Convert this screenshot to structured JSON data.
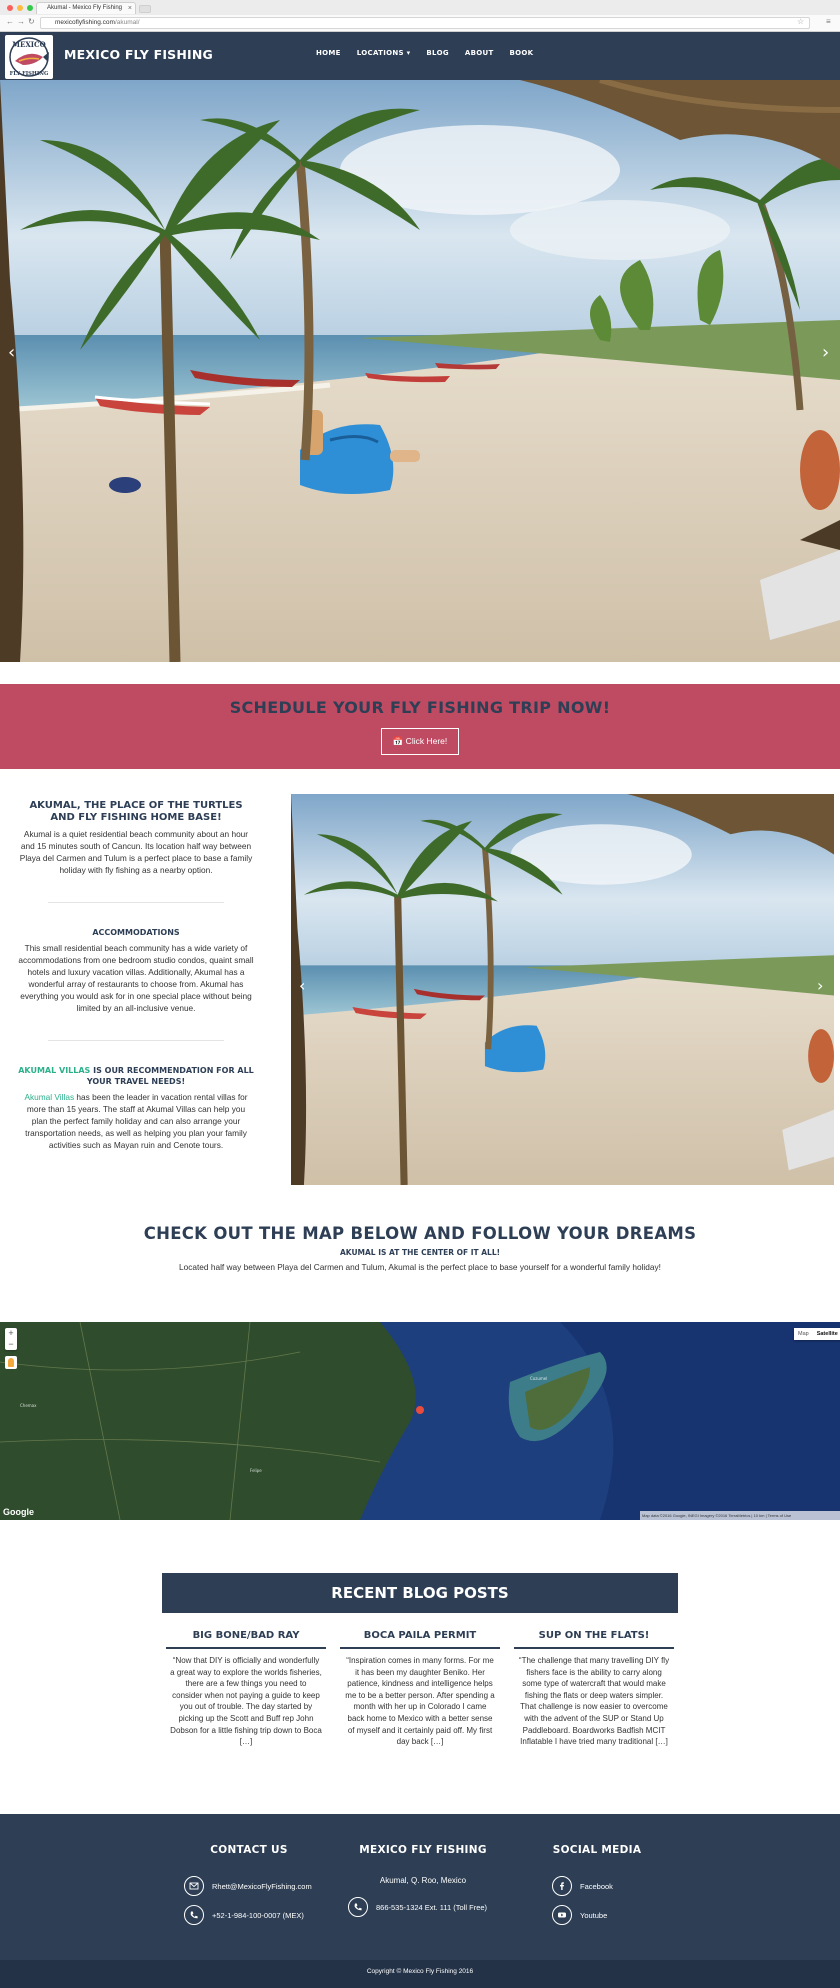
{
  "browser": {
    "tab_title": "Akumal - Mexico Fly Fishing",
    "tab_close": "×",
    "url_domain": "mexicoflyfishing.com",
    "url_path": "/akumal/"
  },
  "header": {
    "logo_text_top": "MEXICO",
    "logo_text_bottom": "FLY FISHING",
    "site_title": "MEXICO FLY FISHING",
    "nav": [
      "HOME",
      "LOCATIONS ▾",
      "BLOG",
      "ABOUT",
      "BOOK"
    ]
  },
  "hero": {
    "prev_arrow": "‹",
    "next_arrow": "›"
  },
  "cta": {
    "heading": "SCHEDULE YOUR FLY FISHING TRIP NOW!",
    "button_label": "📅 Click Here!"
  },
  "akumal": {
    "heading": "AKUMAL, THE PLACE OF THE TURTLES AND FLY FISHING HOME BASE!",
    "intro": "Akumal is a quiet residential beach community about an hour and 15 minutes south of Cancun. Its location half way between Playa del Carmen and Tulum is a perfect place to base a family holiday with fly fishing as a nearby option.",
    "accommodations_heading": "ACCOMMODATIONS",
    "accommodations_text": "This small residential beach community has a wide variety of accommodations from one bedroom studio condos, quaint small hotels and luxury vacation villas. Additionally, Akumal has a wonderful array of restaurants to choose from. Akumal has everything you would ask for in one special place without being limited by an all-inclusive venue.",
    "villas_link": "AKUMAL VILLAS",
    "villas_heading_rest": " IS OUR RECOMMENDATION FOR ALL YOUR TRAVEL NEEDS!",
    "villas_text_link": "Akumal Villas",
    "villas_text": " has been the leader in vacation rental villas for more than 15 years. The staff at Akumal Villas can help you plan the perfect family holiday and can also arrange your transportation needs, as well as helping you plan your family activities such as Mayan ruin and Cenote tours."
  },
  "map_section": {
    "heading": "CHECK OUT THE MAP BELOW AND FOLLOW YOUR DREAMS",
    "subheading": "AKUMAL IS AT THE CENTER OF IT ALL!",
    "text": "Located half way between Playa del Carmen and Tulum, Akumal is the perfect place to base yourself for a wonderful family holiday!",
    "zoom_in": "+",
    "zoom_out": "−",
    "map_type_map": "Map",
    "map_type_satellite": "Satellite",
    "google": "Google",
    "attribution": "Map data ©2016 Google, INEGI Imagery ©2016 TerraMetrics | 10 km | Terms of Use"
  },
  "blog": {
    "heading": "RECENT BLOG POSTS",
    "posts": [
      {
        "title": "BIG BONE/BAD RAY",
        "excerpt": "“Now that DIY is officially and wonderfully a great way to explore the worlds fisheries, there are a few things you need to consider when not paying a guide to keep you out of trouble. The day started by picking up the Scott and Buff rep John Dobson for a little fishing trip down to Boca […]"
      },
      {
        "title": "BOCA PAILA PERMIT",
        "excerpt": "“Inspiration comes in many forms. For me it has been my daughter Beniko. Her patience, kindness and intelligence helps me to be a better person. After spending a month with her up in Colorado I came back home to Mexico with a better sense of myself and it certainly paid off.  My first day back […]"
      },
      {
        "title": "SUP ON THE FLATS!",
        "excerpt": "“The challenge that many travelling DIY fly fishers face is the ability to carry along some type of watercraft that would make fishing the flats or deep waters simpler. That challenge is now easier to overcome with the advent of the SUP or Stand Up Paddleboard. Boardworks Badfish MCIT Inflatable I have tried many traditional […]"
      }
    ]
  },
  "footer": {
    "contact_heading": "CONTACT US",
    "email": "Rhett@MexicoFlyFishing.com",
    "phone_mx": "+52-1-984-100-0007 (MEX)",
    "brand_heading": "MEXICO FLY FISHING",
    "location": "Akumal, Q. Roo, Mexico",
    "phone_tollfree": "866-535-1324  Ext. 111 (Toll Free)",
    "social_heading": "SOCIAL MEDIA",
    "facebook": "Facebook",
    "youtube": "Youtube",
    "copyright": "Copyright © Mexico Fly Fishing 2016"
  },
  "colors": {
    "navy": "#2d3e55",
    "cta_red": "#bf4b63",
    "link_green": "#2bb08a"
  }
}
